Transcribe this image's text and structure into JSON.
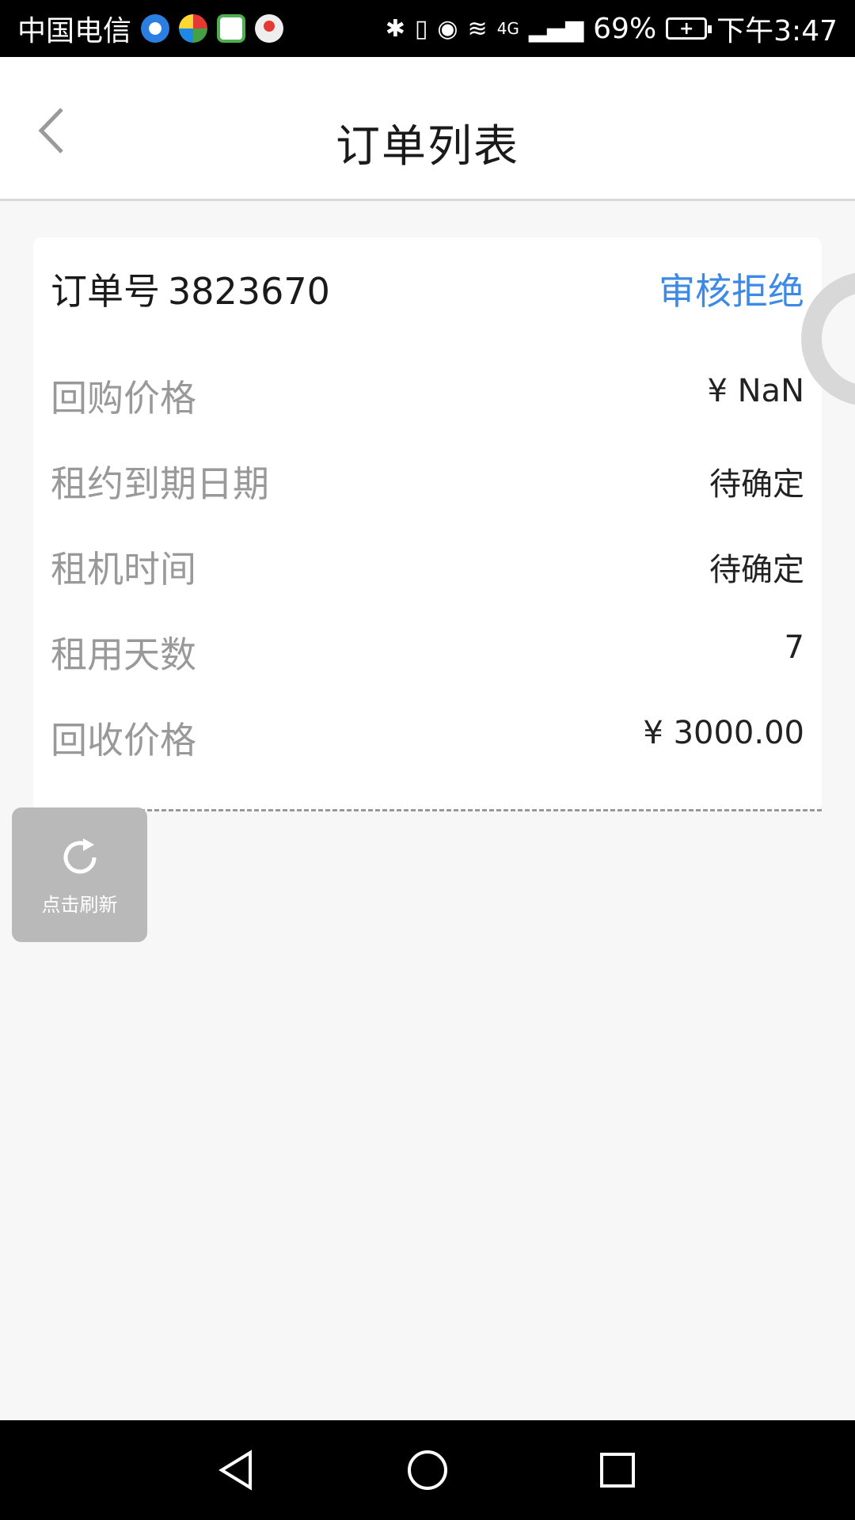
{
  "status_bar": {
    "carrier": "中国电信",
    "battery": "69%",
    "time": "下午3:47",
    "network": "4G"
  },
  "header": {
    "title": "订单列表"
  },
  "order": {
    "label": "订单号",
    "number": "3823670",
    "status": "审核拒绝",
    "status_color": "#3c8ae6",
    "rows": [
      {
        "label": "回购价格",
        "value": "¥ NaN"
      },
      {
        "label": "租约到期日期",
        "value": "待确定"
      },
      {
        "label": "租机时间",
        "value": "待确定"
      },
      {
        "label": "租用天数",
        "value": "7"
      },
      {
        "label": "回收价格",
        "value": "¥ 3000.00"
      }
    ]
  },
  "refresh": {
    "label": "点击刷新"
  },
  "icons": {
    "back": "chevron-left-icon",
    "refresh": "refresh-icon",
    "nav_back": "triangle-back-icon",
    "nav_home": "circle-home-icon",
    "nav_recent": "square-recent-icon"
  }
}
